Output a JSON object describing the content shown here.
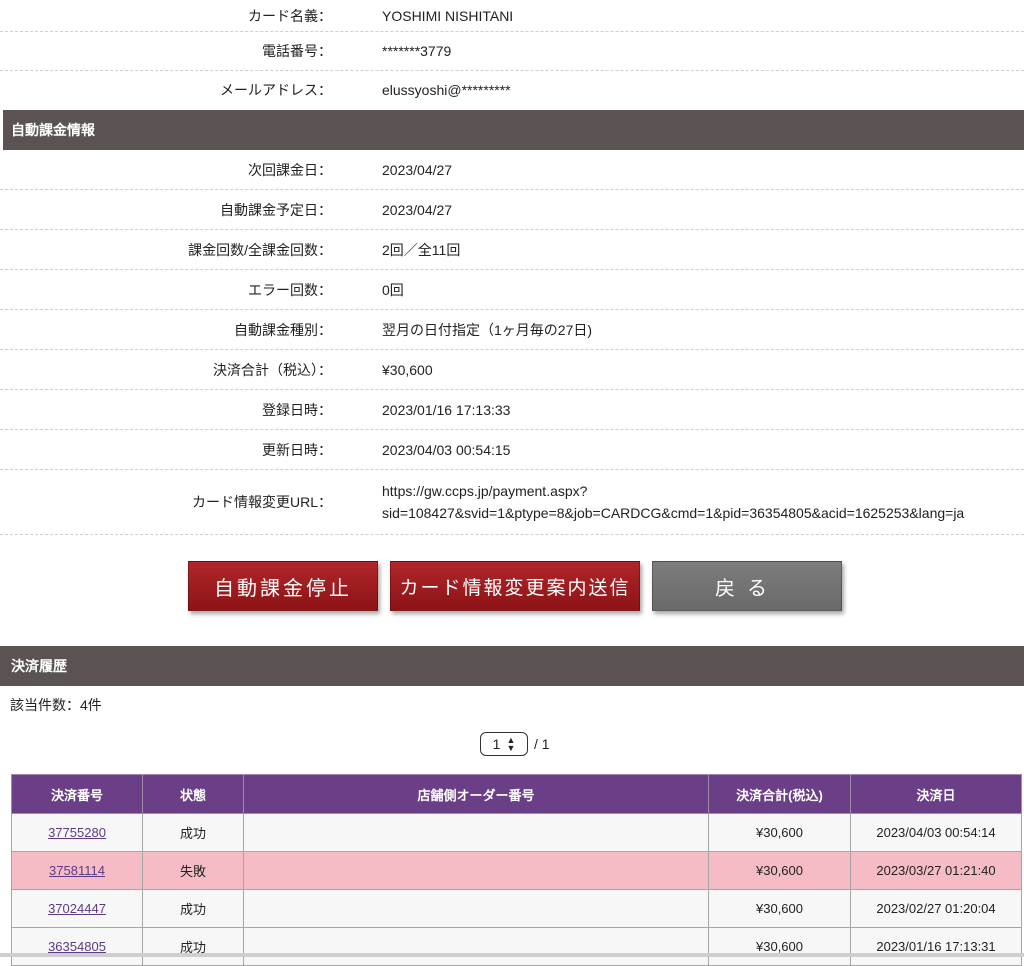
{
  "card_info": {
    "rows": [
      {
        "label": "カード名義：",
        "value": "YOSHIMI NISHITANI"
      },
      {
        "label": "電話番号：",
        "value": "*******3779"
      },
      {
        "label": "メールアドレス：",
        "value": "elussyoshi@*********"
      }
    ]
  },
  "auto_billing": {
    "header": "自動課金情報",
    "rows": [
      {
        "label": "次回課金日：",
        "value": "2023/04/27"
      },
      {
        "label": "自動課金予定日：",
        "value": "2023/04/27"
      },
      {
        "label": "課金回数/全課金回数：",
        "value": "2回／全11回"
      },
      {
        "label": "エラー回数：",
        "value": "0回"
      },
      {
        "label": "自動課金種別：",
        "value": "翌月の日付指定（1ヶ月毎の27日)"
      },
      {
        "label": "決済合計（税込）：",
        "value": "¥30,600"
      },
      {
        "label": "登録日時：",
        "value": "2023/01/16 17:13:33"
      },
      {
        "label": "更新日時：",
        "value": "2023/04/03 00:54:15"
      }
    ],
    "url_row": {
      "label": "カード情報変更URL：",
      "line1": "https://gw.ccps.jp/payment.aspx?",
      "line2": "sid=108427&svid=1&ptype=8&job=CARDCG&cmd=1&pid=36354805&acid=1625253&lang=ja"
    }
  },
  "buttons": {
    "stop": "自動課金停止",
    "send": "カード情報変更案内送信",
    "back": "戻る"
  },
  "history": {
    "header": "決済履歴",
    "count_text": "該当件数：4件",
    "page_select": "1",
    "page_total": "/ 1",
    "columns": [
      "決済番号",
      "状態",
      "店舗側オーダー番号",
      "決済合計(税込)",
      "決済日"
    ],
    "rows": [
      {
        "id": "37755280",
        "status": "成功",
        "order": "",
        "amount": "¥30,600",
        "date": "2023/04/03 00:54:14"
      },
      {
        "id": "37581114",
        "status": "失敗",
        "order": "",
        "amount": "¥30,600",
        "date": "2023/03/27 01:21:40"
      },
      {
        "id": "37024447",
        "status": "成功",
        "order": "",
        "amount": "¥30,600",
        "date": "2023/02/27 01:20:04"
      },
      {
        "id": "36354805",
        "status": "成功",
        "order": "",
        "amount": "¥30,600",
        "date": "2023/01/16 17:13:31"
      }
    ]
  },
  "colors": {
    "section_bar": "#5a5352",
    "table_header": "#6b3f87",
    "button_red": "#9e1c20",
    "button_gray": "#737373",
    "fail_row": "#f6bcc5",
    "link": "#5b3a88"
  }
}
